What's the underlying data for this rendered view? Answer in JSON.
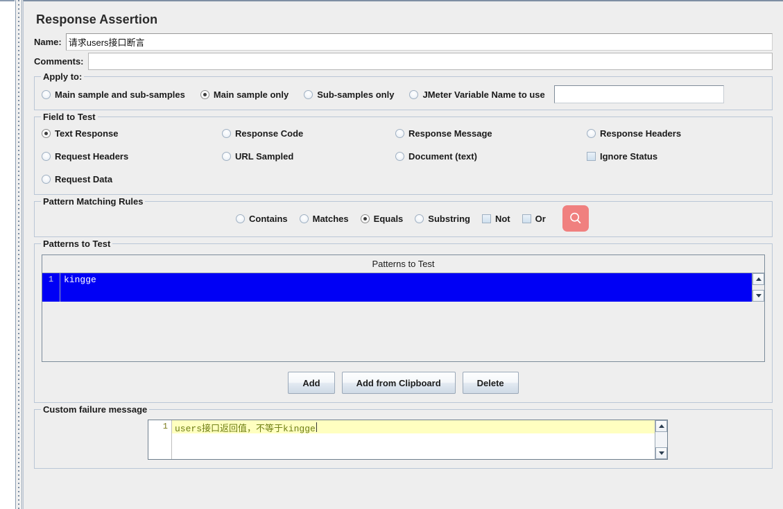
{
  "page_title": "Response Assertion",
  "fields": {
    "name_label": "Name:",
    "name_value": "请求users接口断言",
    "comments_label": "Comments:",
    "comments_value": ""
  },
  "apply_to": {
    "title": "Apply to:",
    "options": [
      {
        "label": "Main sample and sub-samples",
        "selected": false
      },
      {
        "label": "Main sample only",
        "selected": true
      },
      {
        "label": "Sub-samples only",
        "selected": false
      },
      {
        "label": "JMeter Variable Name to use",
        "selected": false
      }
    ],
    "variable_name_value": ""
  },
  "field_to_test": {
    "title": "Field to Test",
    "options": [
      {
        "label": "Text Response",
        "selected": true,
        "type": "radio"
      },
      {
        "label": "Response Code",
        "selected": false,
        "type": "radio"
      },
      {
        "label": "Response Message",
        "selected": false,
        "type": "radio"
      },
      {
        "label": "Response Headers",
        "selected": false,
        "type": "radio"
      },
      {
        "label": "Request Headers",
        "selected": false,
        "type": "radio"
      },
      {
        "label": "URL Sampled",
        "selected": false,
        "type": "radio"
      },
      {
        "label": "Document (text)",
        "selected": false,
        "type": "radio"
      },
      {
        "label": "Ignore Status",
        "selected": false,
        "type": "checkbox"
      },
      {
        "label": "Request Data",
        "selected": false,
        "type": "radio"
      }
    ]
  },
  "pattern_matching_rules": {
    "title": "Pattern Matching Rules",
    "options": [
      {
        "label": "Contains",
        "selected": false,
        "type": "radio"
      },
      {
        "label": "Matches",
        "selected": false,
        "type": "radio"
      },
      {
        "label": "Equals",
        "selected": true,
        "type": "radio"
      },
      {
        "label": "Substring",
        "selected": false,
        "type": "radio"
      },
      {
        "label": "Not",
        "selected": false,
        "type": "checkbox"
      },
      {
        "label": "Or",
        "selected": false,
        "type": "checkbox"
      }
    ],
    "search_button_color": "#f0807f",
    "search_icon": "search-icon"
  },
  "patterns_to_test": {
    "title": "Patterns to Test",
    "column_header": "Patterns to Test",
    "rows": [
      {
        "number": "1",
        "value": "kingge",
        "selected": true
      }
    ],
    "selection_color": "#0000f5",
    "buttons": [
      {
        "label": "Add"
      },
      {
        "label": "Add from Clipboard"
      },
      {
        "label": "Delete"
      }
    ]
  },
  "custom_failure_message": {
    "title": "Custom failure message",
    "lines": [
      {
        "number": "1",
        "text": "users接口返回值，不等于kingge"
      }
    ],
    "highlight_color": "#ffffc0",
    "text_color": "#6f7f13"
  },
  "scrollbar": {
    "up_arrow": "triangle-up-icon",
    "down_arrow": "triangle-down-icon"
  }
}
